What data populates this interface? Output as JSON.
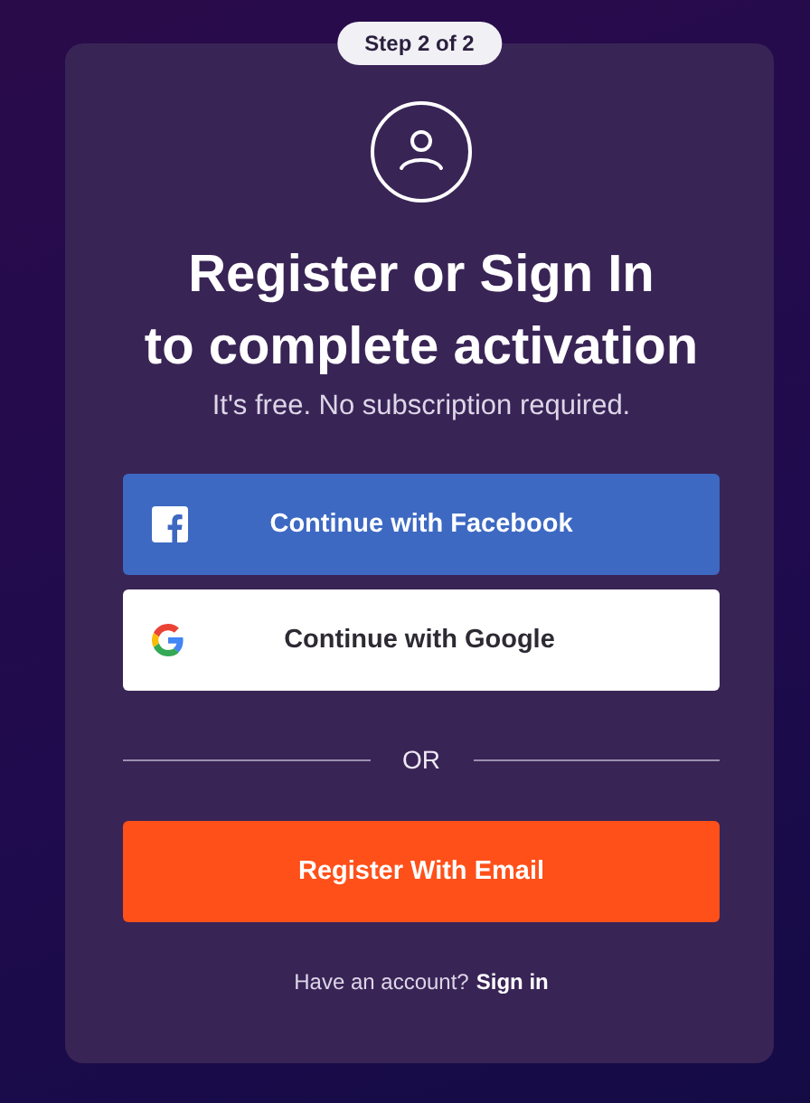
{
  "step_badge": "Step 2 of 2",
  "title_lines": [
    "Register or Sign In",
    "to complete activation"
  ],
  "subtitle": "It's free. No subscription required.",
  "social_buttons": [
    {
      "kind": "facebook",
      "label": "Continue with Facebook"
    },
    {
      "kind": "google",
      "label": "Continue with Google"
    }
  ],
  "divider_label": "OR",
  "email_button": "Register With Email",
  "footer": {
    "prompt": "Have an account?",
    "link": "Sign in"
  }
}
